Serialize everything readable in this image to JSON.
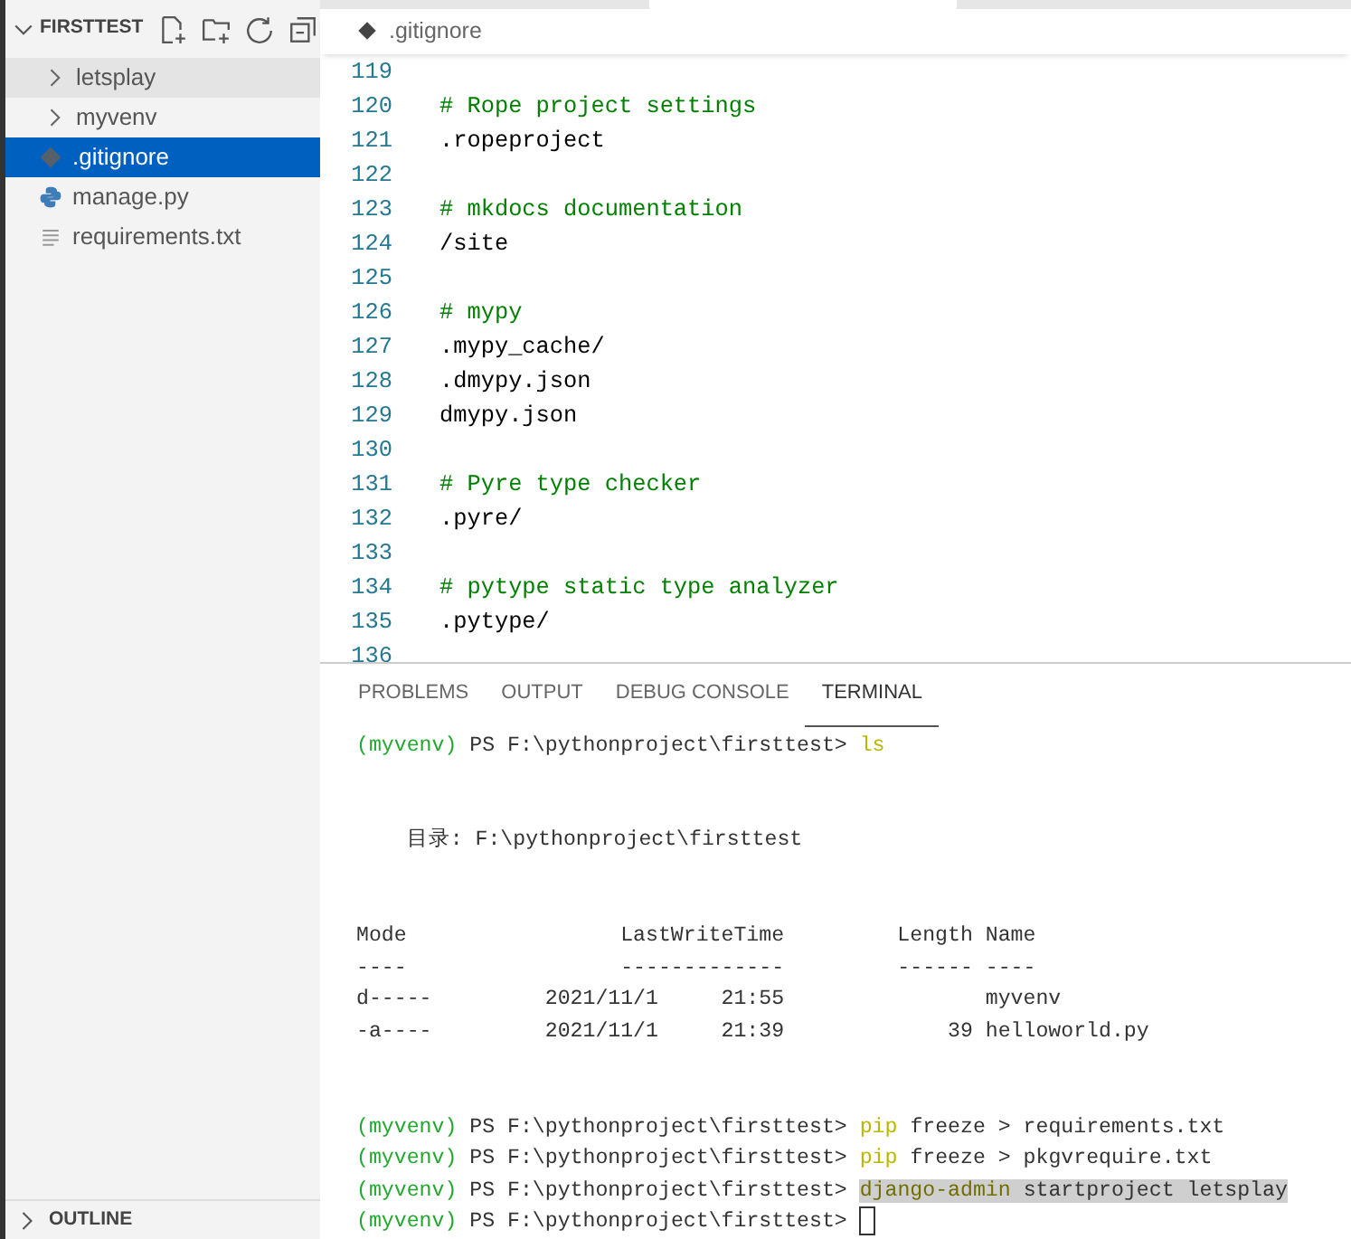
{
  "sidebar": {
    "title": "FIRSTTEST",
    "items": [
      {
        "label": "letsplay",
        "kind": "folder",
        "selected": false,
        "hovered": true
      },
      {
        "label": "myvenv",
        "kind": "folder",
        "selected": false,
        "hovered": false
      },
      {
        "label": ".gitignore",
        "kind": "git",
        "selected": true,
        "hovered": false
      },
      {
        "label": "manage.py",
        "kind": "python",
        "selected": false,
        "hovered": false
      },
      {
        "label": "requirements.txt",
        "kind": "text",
        "selected": false,
        "hovered": false
      }
    ],
    "outline": {
      "label": "OUTLINE"
    }
  },
  "editor": {
    "breadcrumb": ".gitignore",
    "lines": [
      {
        "number": "119",
        "kind": "blank"
      },
      {
        "number": "120",
        "kind": "comment",
        "text": "# Rope project settings"
      },
      {
        "number": "121",
        "kind": "code",
        "text": ".ropeproject"
      },
      {
        "number": "122",
        "kind": "blank"
      },
      {
        "number": "123",
        "kind": "comment",
        "text": "# mkdocs documentation"
      },
      {
        "number": "124",
        "kind": "code",
        "text": "/site"
      },
      {
        "number": "125",
        "kind": "blank"
      },
      {
        "number": "126",
        "kind": "comment",
        "text": "# mypy"
      },
      {
        "number": "127",
        "kind": "code",
        "text": ".mypy_cache/"
      },
      {
        "number": "128",
        "kind": "code",
        "text": ".dmypy.json"
      },
      {
        "number": "129",
        "kind": "code",
        "text": "dmypy.json"
      },
      {
        "number": "130",
        "kind": "blank"
      },
      {
        "number": "131",
        "kind": "comment",
        "text": "# Pyre type checker"
      },
      {
        "number": "132",
        "kind": "code",
        "text": ".pyre/"
      },
      {
        "number": "133",
        "kind": "blank"
      },
      {
        "number": "134",
        "kind": "comment",
        "text": "# pytype static type analyzer"
      },
      {
        "number": "135",
        "kind": "code",
        "text": ".pytype/"
      },
      {
        "number": "136",
        "kind": "blank"
      }
    ]
  },
  "panel": {
    "tabs": [
      {
        "label": "PROBLEMS",
        "selected": false
      },
      {
        "label": "OUTPUT",
        "selected": false
      },
      {
        "label": "DEBUG CONSOLE",
        "selected": false
      },
      {
        "label": "TERMINAL",
        "selected": true
      }
    ],
    "terminal": [
      {
        "kind": "prompt",
        "env": "(myvenv)",
        "prompt": "PS F:\\pythonproject\\firsttest>",
        "command": "ls",
        "selected": false,
        "cursor": false
      },
      {
        "kind": "blank"
      },
      {
        "kind": "blank"
      },
      {
        "kind": "output",
        "text": "    目录: F:\\pythonproject\\firsttest"
      },
      {
        "kind": "blank"
      },
      {
        "kind": "blank"
      },
      {
        "kind": "output",
        "text": "Mode                 LastWriteTime         Length Name"
      },
      {
        "kind": "output",
        "text": "----                 -------------         ------ ----"
      },
      {
        "kind": "output",
        "text": "d-----         2021/11/1     21:55                myvenv"
      },
      {
        "kind": "output",
        "text": "-a----         2021/11/1     21:39             39 helloworld.py"
      },
      {
        "kind": "blank"
      },
      {
        "kind": "blank"
      },
      {
        "kind": "prompt",
        "env": "(myvenv)",
        "prompt": "PS F:\\pythonproject\\firsttest>",
        "command": "pip",
        "args": "freeze > requirements.txt",
        "selected": false,
        "cursor": false
      },
      {
        "kind": "prompt",
        "env": "(myvenv)",
        "prompt": "PS F:\\pythonproject\\firsttest>",
        "command": "pip",
        "args": "freeze > pkgvrequire.txt",
        "selected": false,
        "cursor": false
      },
      {
        "kind": "prompt",
        "env": "(myvenv)",
        "prompt": "PS F:\\pythonproject\\firsttest>",
        "command": "django-admin",
        "args": "startproject letsplay",
        "selected": true,
        "cursor": false
      },
      {
        "kind": "prompt",
        "env": "(myvenv)",
        "prompt": "PS F:\\pythonproject\\firsttest>",
        "selected": false,
        "cursor": true
      }
    ]
  }
}
